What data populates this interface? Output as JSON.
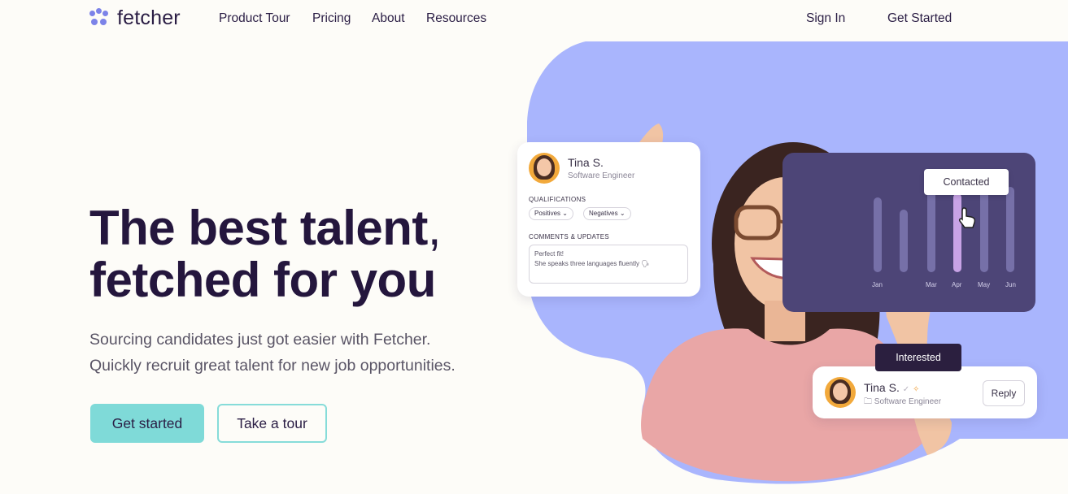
{
  "nav": {
    "brand": "fetcher",
    "links": [
      "Product Tour",
      "Pricing",
      "About",
      "Resources"
    ],
    "sign_in": "Sign In",
    "get_started": "Get Started"
  },
  "hero": {
    "title_bold": "The best talent",
    "title_comma": ",",
    "title_light": "fetched for you",
    "subtitle_line1": "Sourcing candidates just got easier with Fetcher.",
    "subtitle_line2": "Quickly recruit great talent for new job opportunities.",
    "primary_cta": "Get started",
    "secondary_cta": "Take a tour"
  },
  "candidate_card": {
    "name": "Tina S.",
    "role": "Software Engineer",
    "qualifications_heading": "QUALIFICATIONS",
    "pill_positives": "Positives",
    "pill_negatives": "Negatives",
    "comments_heading": "COMMENTS & UPDATES",
    "comment_line1": "Perfect fit!",
    "comment_line2": "She speaks three languages fluently 🗣"
  },
  "chart_card": {
    "tooltip": "Contacted",
    "months": [
      "Jan",
      "Mar",
      "Apr",
      "May",
      "Jun"
    ],
    "highlight_month": "Apr"
  },
  "reply_card": {
    "badge": "Interested",
    "name": "Tina S.",
    "role": "Software Engineer",
    "reply": "Reply"
  },
  "colors": {
    "accent_teal": "#7fdad8",
    "blob_periwinkle": "#a9b5fd",
    "dark_purple": "#24163d",
    "chart_bg": "#4d4577",
    "highlight_bar": "#c8a3e6"
  },
  "icons": {
    "logo": "paw-icon",
    "cursor": "hand-pointer-icon",
    "folder": "folder-icon",
    "chevron": "chevron-down-icon"
  }
}
